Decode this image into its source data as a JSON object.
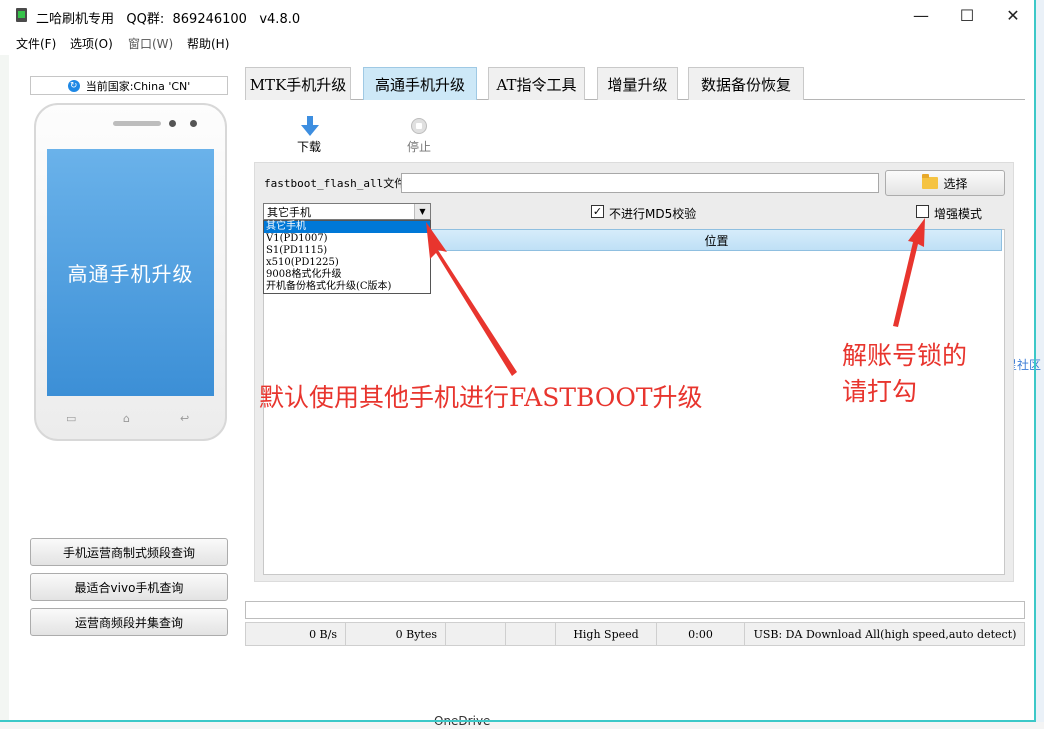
{
  "window": {
    "title": "二哈刷机专用   QQ群:  869246100   v4.8.0",
    "controls": [
      "—",
      "☐",
      "✕"
    ]
  },
  "menu": [
    "文件(F)",
    "选项(O)",
    "窗口(W)",
    "帮助(H)"
  ],
  "left_panel": {
    "country": "当前国家:China 'CN'",
    "phone_screen_text": "高通手机升级",
    "buttons": [
      "手机运营商制式频段查询",
      "最适合vivo手机查询",
      "运营商频段并集查询"
    ]
  },
  "tabs": [
    {
      "label": "MTK手机升级",
      "active": false
    },
    {
      "label": "高通手机升级",
      "active": true
    },
    {
      "label": "AT指令工具",
      "active": false
    },
    {
      "label": "增量升级",
      "active": false
    },
    {
      "label": "数据备份恢复",
      "active": false
    }
  ],
  "toolbar": {
    "download": "下载",
    "stop": "停止"
  },
  "form": {
    "file_label": "fastboot_flash_all文件",
    "file_value": "",
    "select_button": "选择",
    "combo_value": "其它手机",
    "dropdown_options": [
      "其它手机",
      "V1(PD1007)",
      "S1(PD1115)",
      "x510(PD1225)",
      "9008格式化升级",
      "开机备份格式化升级(C版本)"
    ],
    "no_md5_label": "不进行MD5校验",
    "no_md5_checked": true,
    "enhanced_label": "增强模式",
    "enhanced_checked": false,
    "grid_header": "位置"
  },
  "status": {
    "speed": "0 B/s",
    "bytes": "0 Bytes",
    "mode": "High Speed",
    "time": "0:00",
    "usb": "USB: DA Download All(high speed,auto detect)"
  },
  "annotations": {
    "left": "默认使用其他手机进行FASTBOOT升级",
    "right_line1": "解账号锁的",
    "right_line2": "请打勾"
  },
  "background": {
    "onedrive": "OneDrive",
    "edge_text": "流星社区"
  },
  "colors": {
    "accent": "#0078d7",
    "annotation": "#e8352e",
    "frame": "#3cc8c8"
  }
}
